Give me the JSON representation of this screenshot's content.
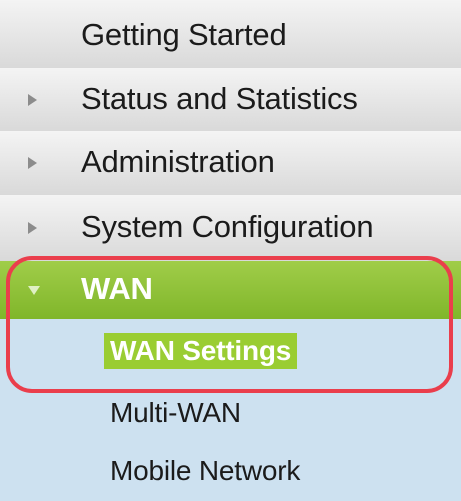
{
  "nav": {
    "items": [
      {
        "label": "Getting Started"
      },
      {
        "label": "Status and Statistics"
      },
      {
        "label": "Administration"
      },
      {
        "label": "System Configuration"
      },
      {
        "label": "WAN"
      }
    ],
    "sub_items": [
      {
        "label": "WAN Settings"
      },
      {
        "label": "Multi-WAN"
      },
      {
        "label": "Mobile Network"
      }
    ]
  },
  "colors": {
    "selected_section": "#8cc13a",
    "highlight": "#9acd32",
    "sub_menu_bg": "#cde1f0",
    "callout_outline": "#ea3e4c"
  },
  "icons": [
    "right-arrow-icon",
    "down-arrow-icon"
  ]
}
